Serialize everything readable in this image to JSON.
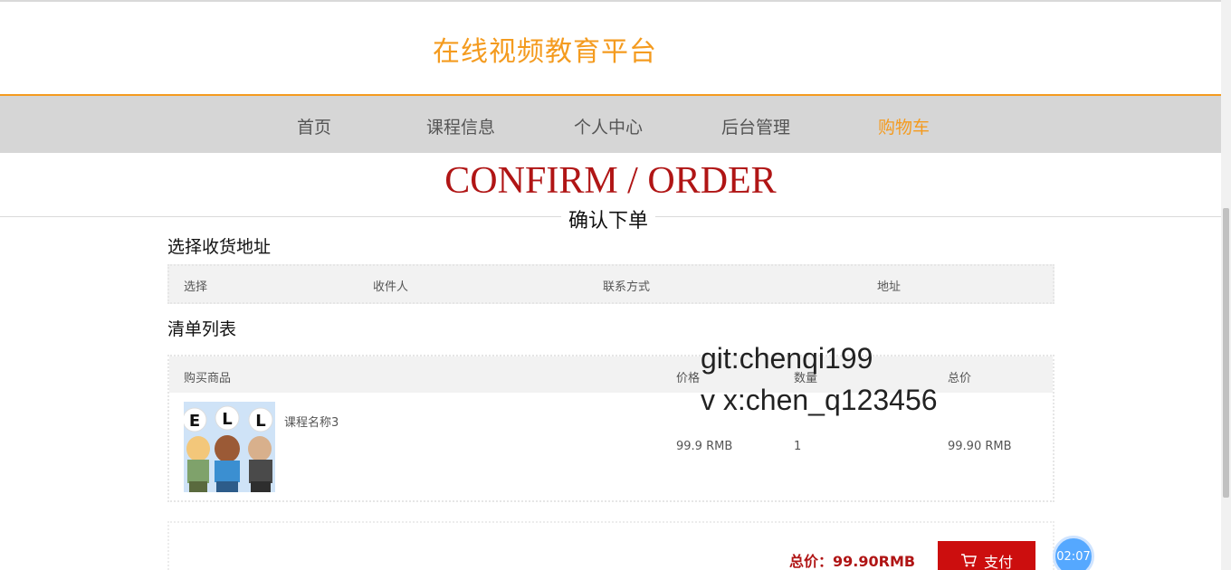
{
  "header": {
    "site_title": "在线视频教育平台"
  },
  "nav": {
    "items": [
      {
        "label": "首页"
      },
      {
        "label": "课程信息"
      },
      {
        "label": "个人中心"
      },
      {
        "label": "后台管理"
      },
      {
        "label": "购物车",
        "active": true
      }
    ]
  },
  "page": {
    "title_en": "CONFIRM / ORDER",
    "title_cn": "确认下单"
  },
  "address_section": {
    "heading": "选择收货地址",
    "columns": [
      "选择",
      "收件人",
      "联系方式",
      "地址"
    ]
  },
  "order_section": {
    "heading": "清单列表",
    "columns": [
      "购买商品",
      "价格",
      "数量",
      "总价"
    ],
    "rows": [
      {
        "product_name": "课程名称3",
        "price": "99.9 RMB",
        "quantity": "1",
        "total": "99.90 RMB"
      }
    ]
  },
  "summary": {
    "total_label": "总价：",
    "total_value": "99.90RMB",
    "pay_label": "支付"
  },
  "watermark": {
    "line1": "git:chenqi199",
    "line2": "v x:chen_q123456"
  },
  "timer": {
    "value": "02:07"
  },
  "colors": {
    "accent": "#f49b1f",
    "title_red": "#b01515",
    "button_red": "#cc0e0e",
    "nav_bg": "#d6d6d6"
  }
}
